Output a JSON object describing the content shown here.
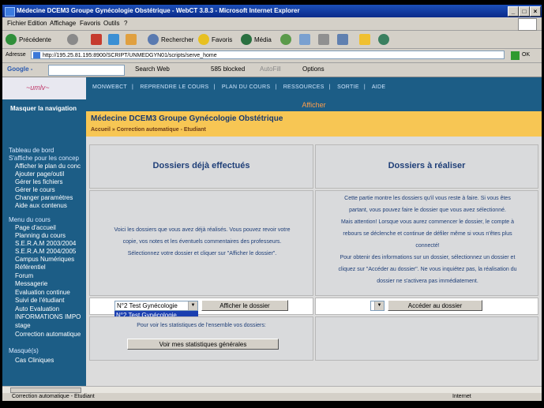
{
  "window": {
    "title": "Médecine DCEM3 Groupe Gynécologie Obstétrique - WebCT 3.8.3 - Microsoft Internet Explorer",
    "minimize": "_",
    "maximize": "□",
    "close": "×"
  },
  "menubar": {
    "items": [
      "Fichier",
      "Edition",
      "Affichage",
      "Favoris",
      "Outils",
      "?"
    ]
  },
  "toolbar": {
    "back": "Précédente",
    "search": "Rechercher",
    "favorites": "Favoris",
    "media": "Média"
  },
  "address": {
    "label": "Adresse",
    "url": "http://195.25.81.195:8900/SCRIPT/UNMEDGYN01/scripts/serve_home",
    "go": "OK"
  },
  "google": {
    "logo": "Google -",
    "search_web": "Search Web",
    "blocked": "585 blocked",
    "autofill": "AutoFill",
    "options": "Options"
  },
  "nav": {
    "top_links": [
      "MONWEBCT",
      "REPRENDRE LE COURS",
      "PLAN DU COURS",
      "RESSOURCES",
      "SORTIE",
      "AIDE"
    ],
    "afficher": "Afficher",
    "hide_nav": "Masquer la navigation",
    "dashboard_title": "Tableau de bord",
    "dashboard_subtitle": "S'affiche pour les concep",
    "dashboard_items": [
      "Afficher le plan du conc",
      "Ajouter page/outil",
      "Gérer les fichiers",
      "Gérer le cours",
      "Changer paramètres",
      "Aide aux contenus"
    ],
    "course_menu_title": "Menu du cours",
    "course_items": [
      "Page d'accueil",
      "Planning du cours",
      "S.E.R.A.M 2003/2004",
      "S.E.R.A.M 2004/2005",
      "Campus Numériques",
      "Référentiel",
      "Forum",
      "Messagerie",
      "Evaluation continue",
      "Suivi de l'étudiant",
      "Auto Evaluation",
      "INFORMATIONS IMPO",
      "stage",
      "Correction automatique"
    ],
    "hidden_title": "Masqué(s)",
    "hidden_items": [
      "Cas Cliniques"
    ]
  },
  "course": {
    "title": "Médecine DCEM3 Groupe Gynécologie Obstétrique",
    "breadcrumb_home": "Accueil",
    "breadcrumb_sep": "»",
    "breadcrumb_current": "Correction automatique - Etudiant"
  },
  "done": {
    "heading": "Dossiers déjà effectués",
    "text_lines": [
      "Voici les dossiers que vous avez déjà réalisés. Vous pouvez revoir votre",
      "copie, vos notes et les éventuels commentaires des professeurs.",
      "Sélectionnez votre dossier et cliquer sur \"Afficher le dossier\"."
    ],
    "select_value": "N°2 Test Gynécologie",
    "dropdown_option": "N°2 Test Gynécologie",
    "show_button": "Afficher le dossier",
    "stats_text": "Pour voir les statistiques de l'ensemble vos dossiers:",
    "stats_button": "Voir mes statistiques générales"
  },
  "todo": {
    "heading": "Dossiers à réaliser",
    "text_lines": [
      "Cette partie montre les dossiers qu'il vous reste à faire. Si vous êtes",
      "partant, vous pouvez faire le dossier que vous avez sélectionné.",
      "Mais attention! Lorsque vous aurez commencer le dossier, le compte à",
      "rebours se déclenche et continue de défiler même si vous n'êtes plus",
      "connecté!",
      "Pour obtenir des informations sur un dossier, sélectionnez un dossier et",
      "cliquez sur \"Accéder au dossier\". Ne vous inquiétez pas, la réalisation du",
      "dossier ne s'activera pas immédiatement."
    ],
    "access_button": "Accéder au dossier"
  },
  "status": {
    "text": "Correction automatique - Etudiant",
    "zone": "Internet"
  },
  "colors": {
    "nav_blue": "#1c5d86",
    "header_yellow": "#f7c654",
    "heading_blue": "#1f3f78",
    "afficher_orange": "#ff9e4a"
  }
}
